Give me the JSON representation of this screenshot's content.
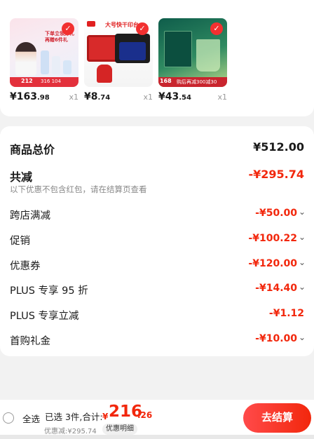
{
  "products": [
    {
      "price_int": "¥163",
      "price_dec": ".98",
      "qty": "x1",
      "banner_text": "下单立领好礼 再赠6件礼",
      "tag_text": "212",
      "footer_text": "316 104"
    },
    {
      "price_int": "¥8",
      "price_dec": ".74",
      "qty": "x1",
      "banner_text": "大号快干印台"
    },
    {
      "price_int": "¥43",
      "price_dec": ".54",
      "qty": "x1",
      "tag_text": "168",
      "banner_text": "购后再减300减30"
    }
  ],
  "summary": {
    "total_label": "商品总价",
    "total_value": "¥512.00",
    "reduce_label": "共减",
    "reduce_value": "-¥295.74",
    "reduce_note": "以下优惠不包含红包，请在结算页查看",
    "items": [
      {
        "label": "跨店满减",
        "value": "-¥50.00"
      },
      {
        "label": "促销",
        "value": "-¥100.22"
      },
      {
        "label": "优惠券",
        "value": "-¥120.00"
      },
      {
        "label": "PLUS 专享 95 折",
        "value": "-¥14.40"
      },
      {
        "label": "PLUS 专享立减",
        "value": "-¥1.12"
      },
      {
        "label": "首购礼金",
        "value": "-¥10.00"
      }
    ]
  },
  "bottom": {
    "select_all": "全选",
    "selected_info": "已选 3件,合计:",
    "currency": "¥",
    "total_int": "216",
    "total_dec": ".26",
    "discount_note": "优惠减:¥295.74",
    "detail_label": "优惠明细",
    "checkout_label": "去结算"
  },
  "colors": {
    "accent": "#f2270c",
    "background": "#f2f2f2"
  },
  "icons": {
    "check": "checkmark-icon",
    "chevron": "chevron-down-icon",
    "radio": "radio-unchecked-icon"
  }
}
